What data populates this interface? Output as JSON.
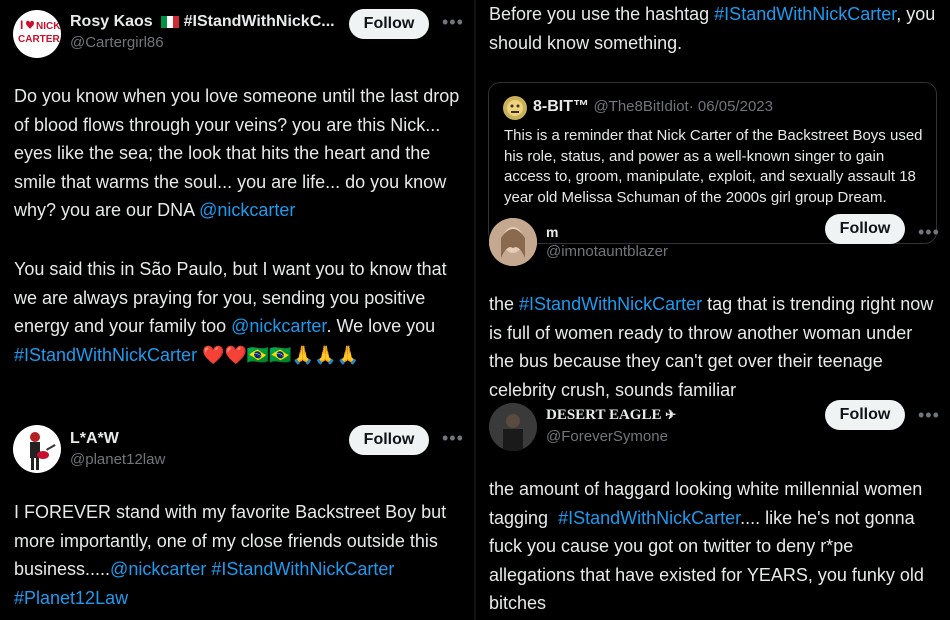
{
  "left": {
    "post1": {
      "name": "Rosy Kaos",
      "name_tail": "#IStandWithNickC...",
      "handle": "@Cartergirl86",
      "follow": "Follow",
      "avatar_logo": "I ♥ NICK CARTER",
      "text_a": "Do you know when you love someone until the last drop of blood flows through your veins? you are this Nick... eyes like the sea; the look that hits the heart and the smile that warms the soul... you are life... do you know why? you are our DNA ",
      "mention_a": "@nickcarter",
      "text_b": "You said this in São Paulo, but I want you to know that we are always praying for you, sending you positive energy and your family too ",
      "mention_b": "@nickcarter",
      "text_b2": ". We love you",
      "hashtag_b": "#IStandWithNickCarter",
      "emojis": "❤️❤️🇧🇷🇧🇷🙏🙏🙏"
    },
    "post2": {
      "name": "L*A*W",
      "handle": "@planet12law",
      "follow": "Follow",
      "text": "I FOREVER stand with my favorite Backstreet Boy but more importantly, one of my close friends outside this business.....",
      "mention": "@nickcarter",
      "hashtag1": "#IStandWithNickCarter",
      "hashtag2": "#Planet12Law"
    }
  },
  "right": {
    "intro_a": "Before you use the hashtag ",
    "intro_hashtag": "#IStandWithNickCarter",
    "intro_b": ", you should know something.",
    "quote": {
      "name": "8-BIT™",
      "handle": "@The8BitIdiot",
      "date": "· 06/05/2023",
      "text": "This is a reminder that Nick Carter of the Backstreet Boys used his role, status, and power as a well-known singer to gain access to, groom, manipulate, exploit, and sexually assault 18 year old Melissa Schuman of the 2000s girl group Dream."
    },
    "post3": {
      "name": "m",
      "handle": "@imnotauntblazer",
      "follow": "Follow",
      "text_a": "the ",
      "hashtag": "#IStandWithNickCarter",
      "text_b": " tag that is trending right now is full of women ready to throw another woman under the bus because they can't get over their teenage celebrity crush, sounds familiar"
    },
    "post4": {
      "name": "DESERT EAGLE",
      "handle": "@ForeverSymone",
      "follow": "Follow",
      "text_a": "the amount of haggard looking white millennial women tagging  ",
      "hashtag": "#IStandWithNickCarter",
      "text_b": ".... like he's not gonna fuck you cause you got on twitter to deny r*pe allegations that have existed for YEARS, you funky old bitches"
    }
  },
  "colors": {
    "link": "#1d9bf0",
    "text": "#e7e9ea",
    "muted": "#71767b",
    "bg": "#000000"
  },
  "icons": [
    "more-icon",
    "italy-flag-icon",
    "eagle-icon"
  ]
}
